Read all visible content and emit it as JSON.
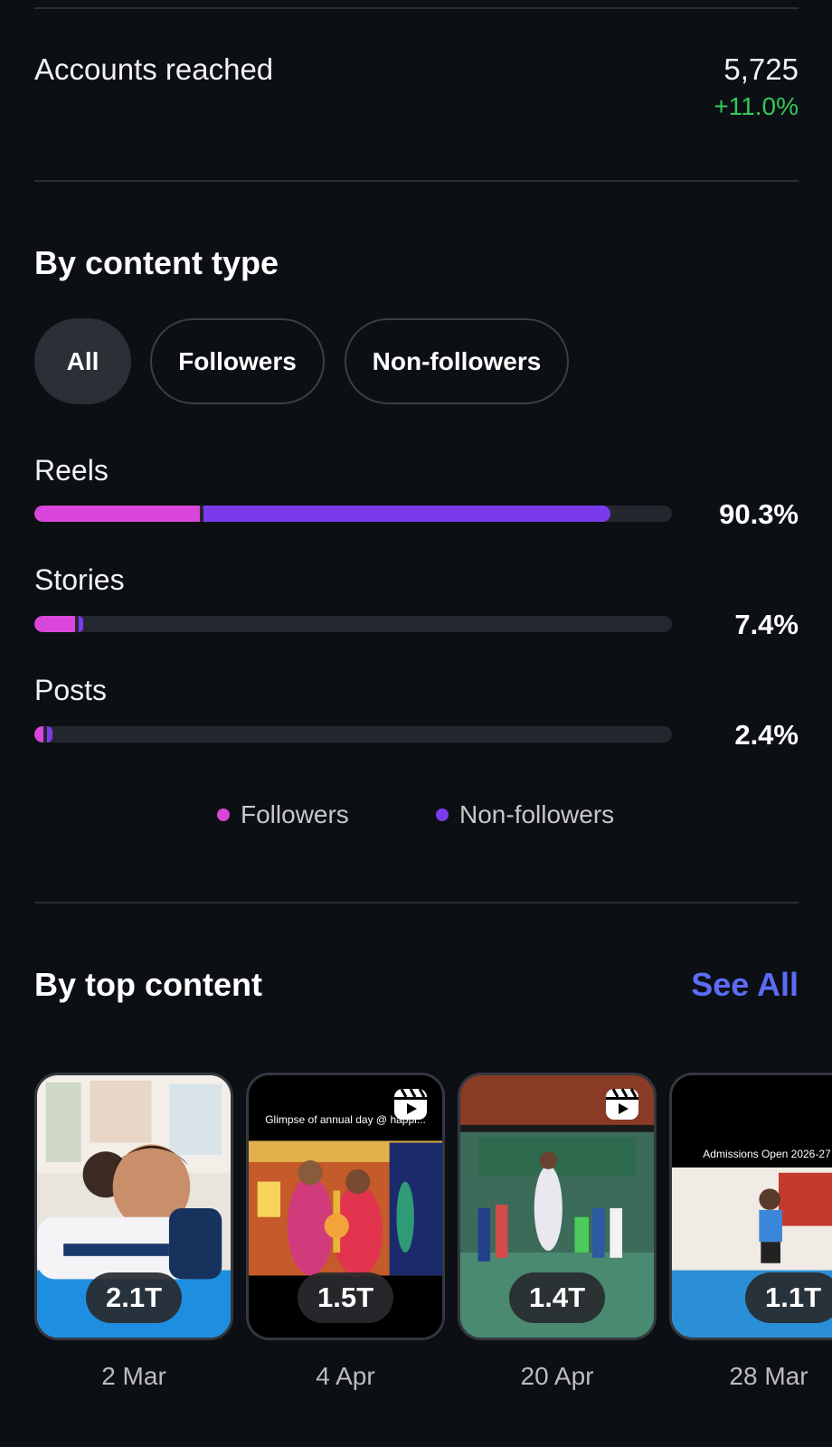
{
  "reach": {
    "label": "Accounts reached",
    "value": "5,725",
    "change": "+11.0%"
  },
  "content_type": {
    "title": "By content type",
    "filters": [
      "All",
      "Followers",
      "Non-followers"
    ],
    "active_filter": "All",
    "metrics": [
      {
        "label": "Reels",
        "percent": "90.3%",
        "followers_share": 0.26,
        "total_share": 0.903
      },
      {
        "label": "Stories",
        "percent": "7.4%",
        "followers_share": 0.064,
        "total_share": 0.077
      },
      {
        "label": "Posts",
        "percent": "2.4%",
        "followers_share": 0.014,
        "total_share": 0.028
      }
    ],
    "legend": {
      "followers": "Followers",
      "non_followers": "Non-followers"
    },
    "colors": {
      "followers": "#d946d9",
      "non_followers": "#7c3aed"
    }
  },
  "top_content": {
    "title": "By top content",
    "see_all": "See All",
    "items": [
      {
        "views": "2.1T",
        "date": "2 Mar",
        "overlay": ""
      },
      {
        "views": "1.5T",
        "date": "4 Apr",
        "overlay": "Glimpse of annual day @ happi..."
      },
      {
        "views": "1.4T",
        "date": "20 Apr",
        "overlay": ""
      },
      {
        "views": "1.1T",
        "date": "28 Mar",
        "overlay": "Admissions Open 2026-27"
      }
    ]
  }
}
